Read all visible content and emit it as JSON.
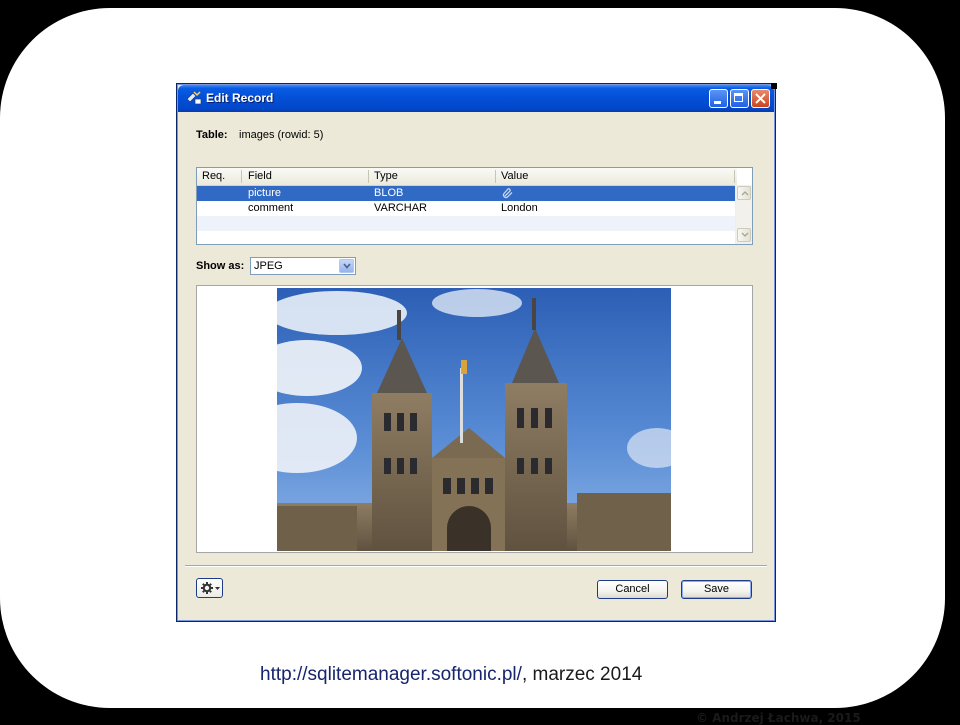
{
  "window": {
    "title": "Edit Record"
  },
  "table_info": {
    "label": "Table:",
    "value": "images (rowid: 5)"
  },
  "grid": {
    "columns": [
      "Req.",
      "Field",
      "Type",
      "Value"
    ],
    "rows": [
      {
        "req": "",
        "field": "picture",
        "type": "BLOB",
        "value": "",
        "value_icon": "paperclip-icon",
        "selected": true
      },
      {
        "req": "",
        "field": "comment",
        "type": "VARCHAR",
        "value": "London",
        "selected": false
      }
    ]
  },
  "show_as": {
    "label": "Show as:",
    "selected": "JPEG"
  },
  "buttons": {
    "cancel": "Cancel",
    "save": "Save"
  },
  "slide": {
    "caption_link": "http://sqlitemanager.softonic.pl/",
    "caption_rest": ", marzec 2014",
    "copyright": "© Andrzej Łachwa, 2015"
  },
  "colors": {
    "titlebar": "#0352da",
    "selection": "#316ac5",
    "window_bg": "#ece9d8"
  }
}
